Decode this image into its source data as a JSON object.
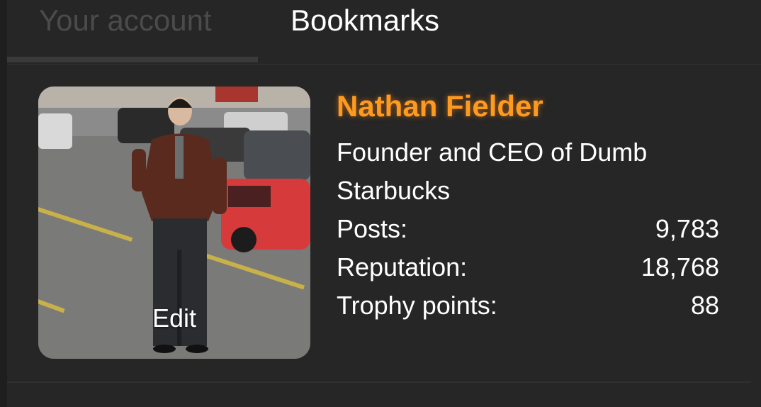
{
  "tabs": [
    {
      "label": "Your account",
      "active": false
    },
    {
      "label": "Bookmarks",
      "active": true
    }
  ],
  "profile": {
    "name": "Nathan Fielder",
    "title": "Founder and CEO of Dumb Starbucks",
    "avatar_edit_label": "Edit",
    "stats": [
      {
        "label": "Posts:",
        "value": "9,783"
      },
      {
        "label": "Reputation:",
        "value": "18,768"
      },
      {
        "label": "Trophy points:",
        "value": "88"
      }
    ]
  },
  "colors": {
    "name_accent": "#ff9a1f",
    "popup_background": "#262626",
    "inactive_tab": "#4b4b4b"
  }
}
